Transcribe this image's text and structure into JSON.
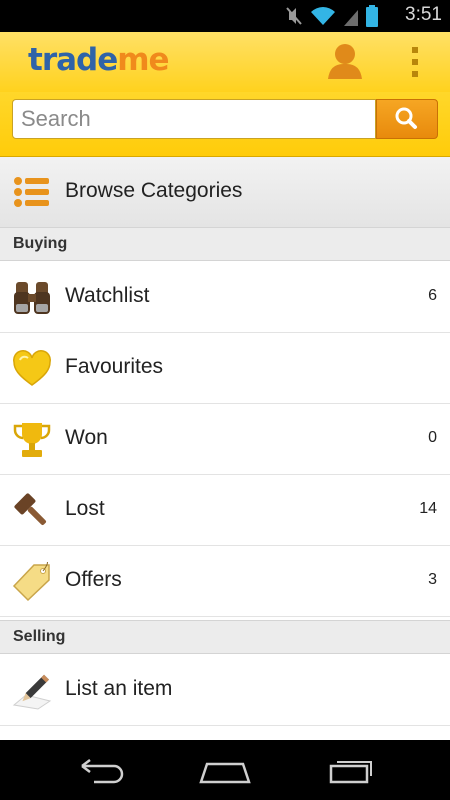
{
  "status_bar": {
    "time": "3:51"
  },
  "action_bar": {
    "logo_part1": "trade",
    "logo_part2": "me",
    "profile_icon": "profile-icon",
    "overflow_icon": "overflow-menu-icon"
  },
  "search": {
    "placeholder": "Search",
    "button_icon": "search-icon"
  },
  "browse": {
    "label": "Browse Categories",
    "icon": "list-icon"
  },
  "sections": {
    "buying": "Buying",
    "selling": "Selling"
  },
  "buying_items": [
    {
      "label": "Watchlist",
      "count": "6",
      "icon": "binoculars-icon"
    },
    {
      "label": "Favourites",
      "count": "",
      "icon": "heart-icon"
    },
    {
      "label": "Won",
      "count": "0",
      "icon": "trophy-icon"
    },
    {
      "label": "Lost",
      "count": "14",
      "icon": "gavel-icon"
    },
    {
      "label": "Offers",
      "count": "3",
      "icon": "tag-icon"
    }
  ],
  "selling_items": [
    {
      "label": "List an item",
      "count": "",
      "icon": "pencil-icon"
    }
  ],
  "colors": {
    "header_yellow": "#ffd21e",
    "logo_blue": "#2f63a8",
    "logo_orange": "#f08a1c",
    "search_button_orange": "#f09a18"
  }
}
